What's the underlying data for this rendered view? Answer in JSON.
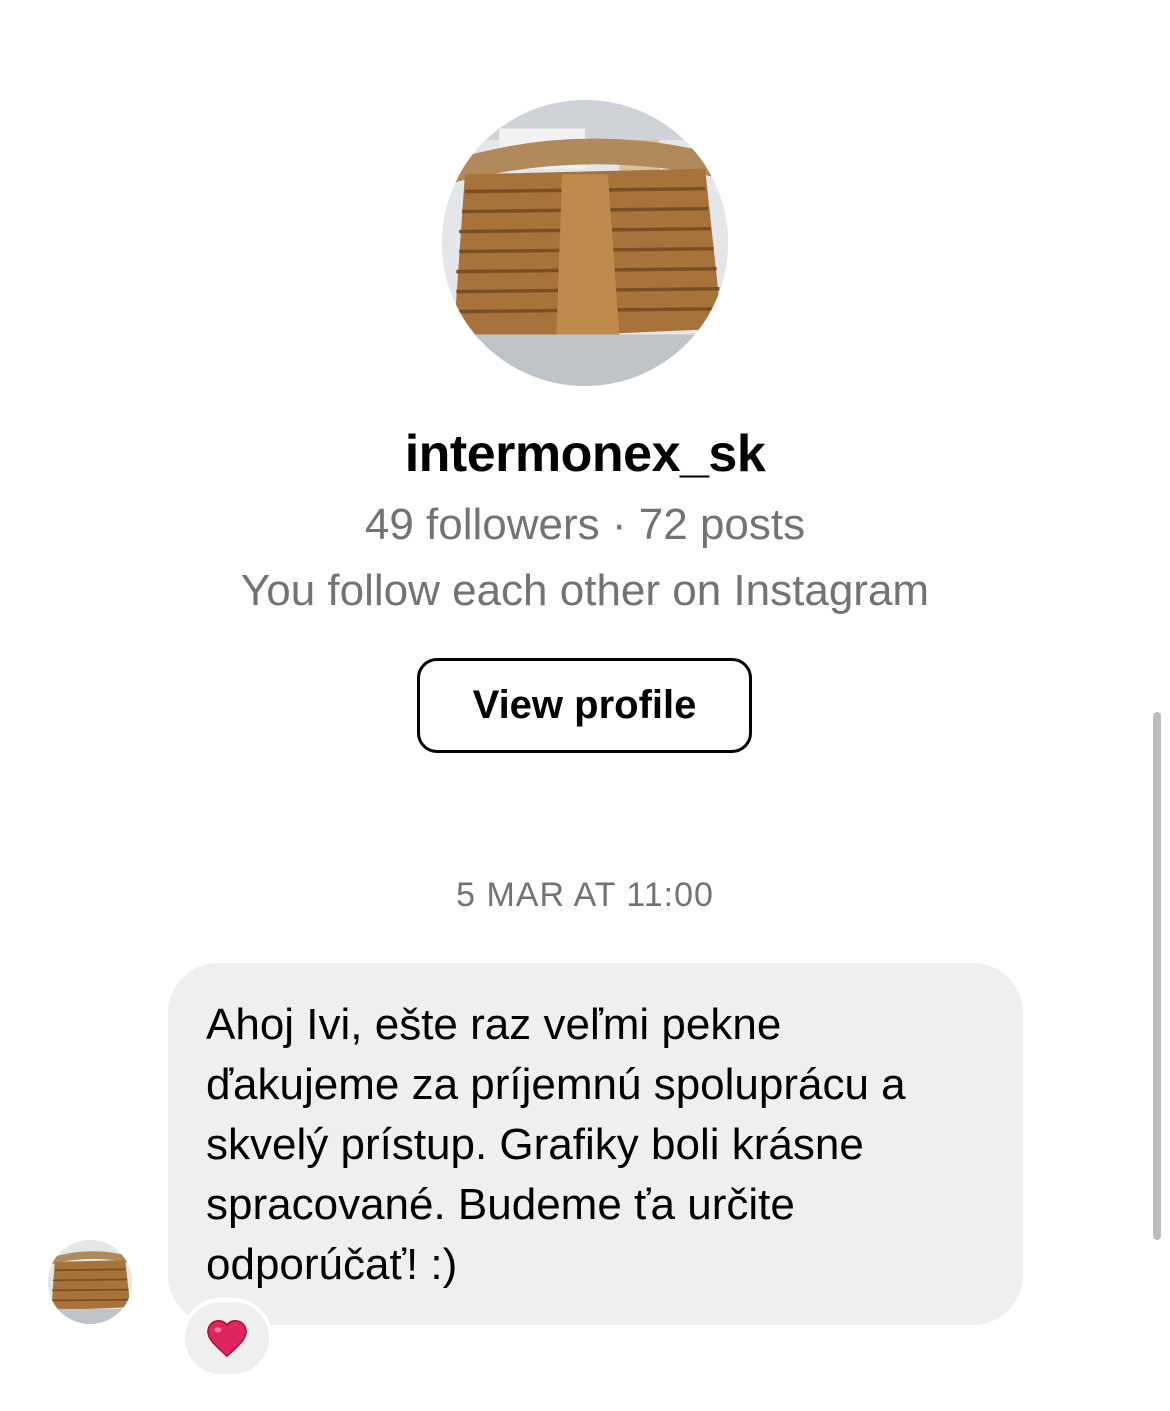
{
  "profile": {
    "avatar_icon": "profile-photo-wooden-stairs",
    "username": "intermonex_sk",
    "stats": "49 followers · 72 posts",
    "mutual": "You follow each other on Instagram",
    "view_profile_label": "View profile"
  },
  "thread": {
    "timestamp": "5 MAR AT 11:00",
    "messages": [
      {
        "sender_avatar_icon": "profile-photo-wooden-stairs",
        "text": "Ahoj Ivi, ešte raz veľmi pekne\nďakujeme za príjemnú spoluprácu a\nskvelý prístup. Grafiky boli krásne\nspracované. Budeme ťa určite\nodporúčať! :)",
        "reaction_icon": "red-heart-icon"
      }
    ]
  },
  "colors": {
    "secondary_text": "#737373",
    "bubble_bg": "#efefef",
    "reaction_heart": "#e0245e"
  }
}
